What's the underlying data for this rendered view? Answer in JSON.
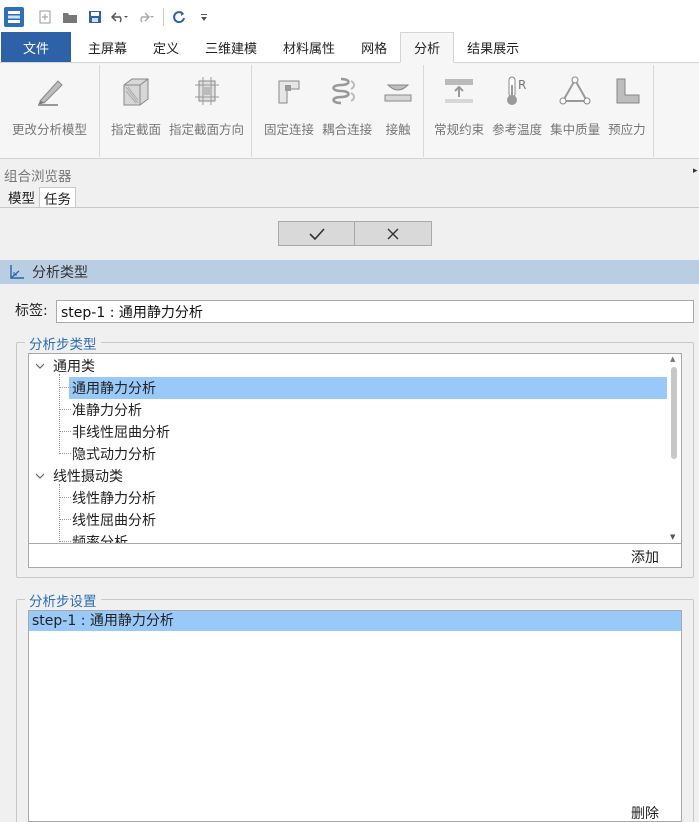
{
  "ribbon_tabs": [
    {
      "label": "文件"
    },
    {
      "label": "主屏幕"
    },
    {
      "label": "定义"
    },
    {
      "label": "三维建模"
    },
    {
      "label": "材料属性"
    },
    {
      "label": "网格"
    },
    {
      "label": "分析"
    },
    {
      "label": "结果展示"
    }
  ],
  "active_tab": "分析",
  "ribbon_buttons": [
    {
      "label": "更改分析模型",
      "icon": "pencil-icon"
    },
    {
      "label": "指定截面",
      "icon": "cube-icon"
    },
    {
      "label": "指定截面方向",
      "icon": "section-orientation-icon"
    },
    {
      "label": "固定连接",
      "icon": "fixed-connection-icon"
    },
    {
      "label": "耦合连接",
      "icon": "coupling-icon"
    },
    {
      "label": "接触",
      "icon": "contact-icon"
    },
    {
      "label": "常规约束",
      "icon": "constraint-icon"
    },
    {
      "label": "参考温度",
      "icon": "thermometer-icon"
    },
    {
      "label": "集中质量",
      "icon": "point-mass-icon"
    },
    {
      "label": "预应力",
      "icon": "prestress-icon"
    }
  ],
  "browser": {
    "title": "组合浏览器",
    "tabs": [
      {
        "label": "模型"
      },
      {
        "label": "任务"
      }
    ],
    "active_tab": "任务"
  },
  "section_title": "分析类型",
  "label_field": {
    "key": "标签:",
    "value": "step-1 : 通用静力分析"
  },
  "step_type_group": {
    "legend": "分析步类型",
    "tree": [
      {
        "label": "通用类",
        "level": 0,
        "expanded": true
      },
      {
        "label": "通用静力分析",
        "level": 1,
        "selected": true
      },
      {
        "label": "准静力分析",
        "level": 1
      },
      {
        "label": "非线性屈曲分析",
        "level": 1
      },
      {
        "label": "隐式动力分析",
        "level": 1
      },
      {
        "label": "线性摄动类",
        "level": 0,
        "expanded": true
      },
      {
        "label": "线性静力分析",
        "level": 1
      },
      {
        "label": "线性屈曲分析",
        "level": 1
      },
      {
        "label": "频率分析",
        "level": 1
      }
    ],
    "add_label": "添加"
  },
  "step_settings_group": {
    "legend": "分析步设置",
    "items": [
      {
        "label": "step-1 : 通用静力分析",
        "selected": true
      }
    ],
    "delete_label": "删除"
  },
  "colors": {
    "file_tab": "#2d62a9",
    "selection": "#99c9f8",
    "section_bar": "#b9cde3",
    "legend_text": "#2c6db5"
  }
}
